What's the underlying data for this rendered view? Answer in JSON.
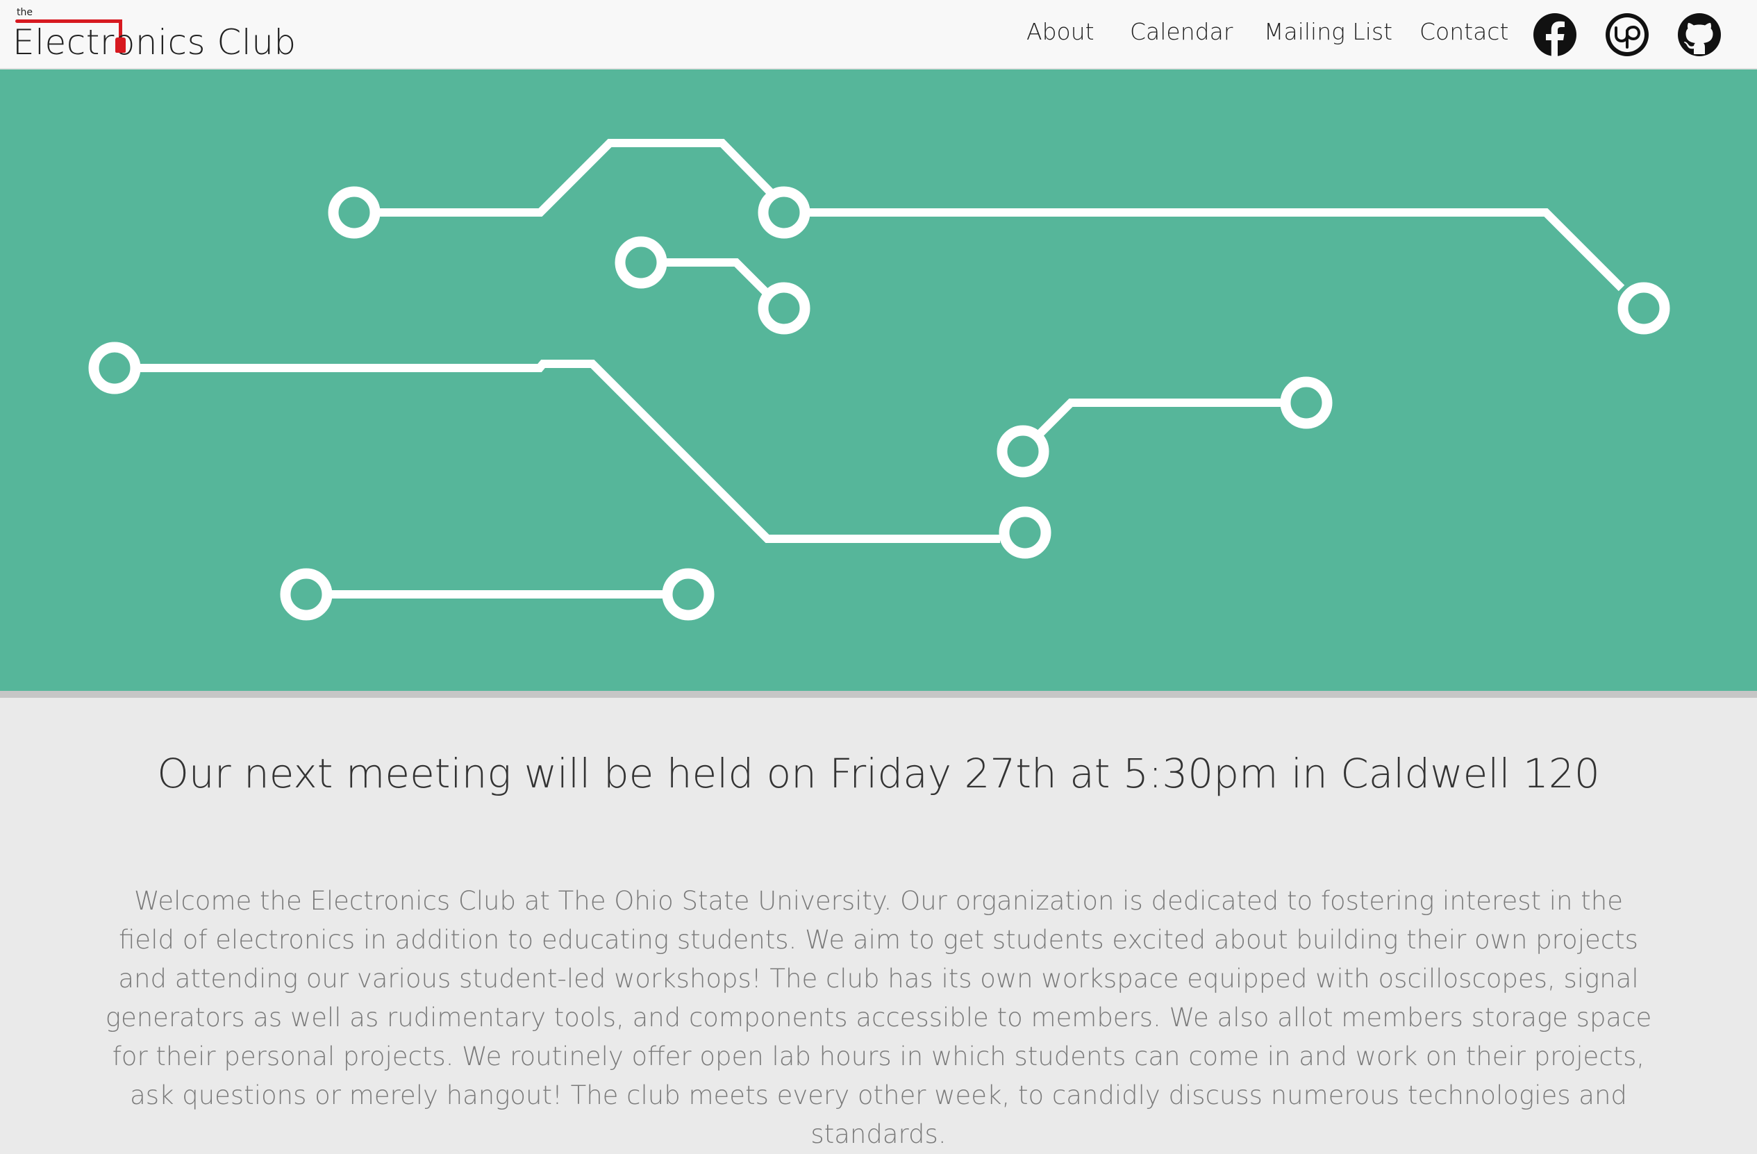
{
  "header": {
    "logo": {
      "small": "the",
      "name": "Electronics Club"
    },
    "nav": [
      {
        "label": "About"
      },
      {
        "label": "Calendar"
      },
      {
        "label": "Mailing List"
      },
      {
        "label": "Contact"
      }
    ],
    "social": [
      {
        "icon": "facebook-icon"
      },
      {
        "icon": "upwork-icon"
      },
      {
        "icon": "github-icon"
      }
    ]
  },
  "hero": {
    "background": "#56b69a",
    "trace_color": "#ffffff",
    "decoration": "circuit-traces"
  },
  "meeting": {
    "text": "Our next meeting will be held on Friday 27th at 5:30pm in Caldwell 120"
  },
  "welcome": {
    "text": "Welcome the Electronics Club at The Ohio State University. Our organization is dedicated to fostering interest in the field of electronics in addition to educating students. We aim to get students excited about building their own projects and attending our various student-led workshops! The club has its own workspace equipped with oscilloscopes, signal generators as well as rudimentary tools, and components accessible to members. We also allot members storage space for their personal projects. We routinely offer open lab hours in which students can come in and work on their projects, ask questions or merely hangout! The club meets every other week, to candidly discuss numerous technologies and standards."
  },
  "colors": {
    "accent": "#d71920",
    "hero": "#56b69a",
    "page_bg": "#eaeaea"
  }
}
